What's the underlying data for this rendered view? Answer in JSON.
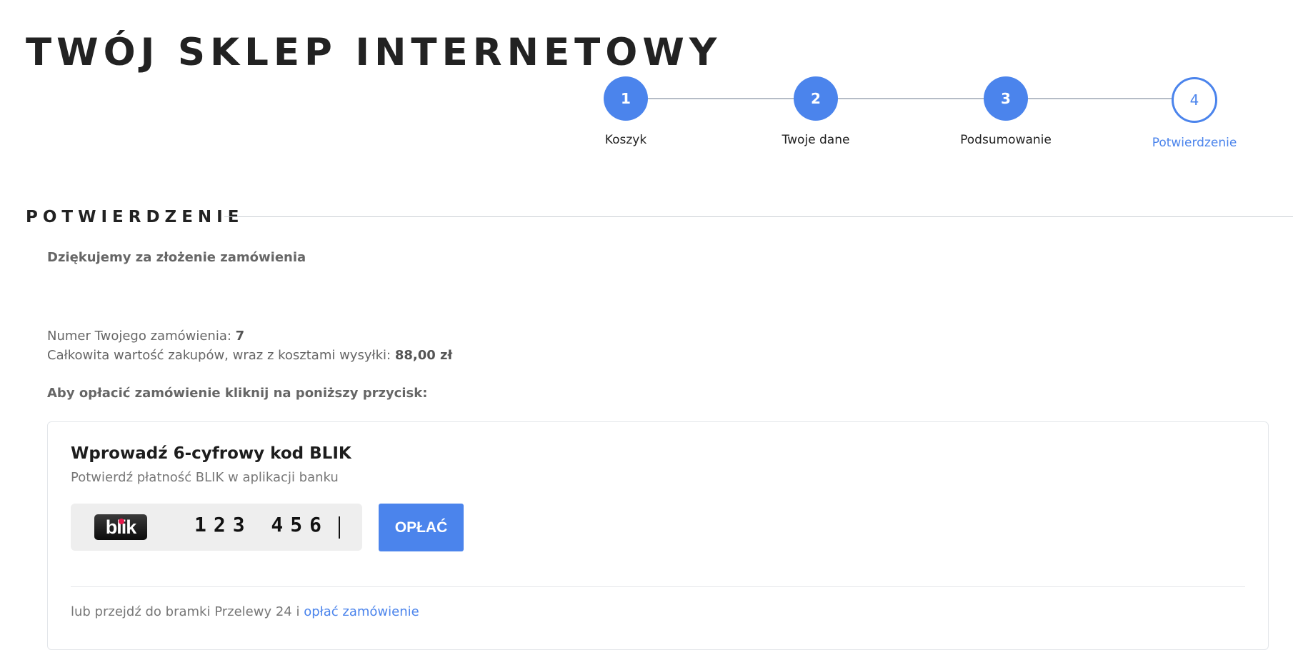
{
  "header": {
    "shop_title": "TWÓJ SKLEP INTERNETOWY"
  },
  "steps": [
    {
      "number": "1",
      "label": "Koszyk",
      "state": "done"
    },
    {
      "number": "2",
      "label": "Twoje dane",
      "state": "done"
    },
    {
      "number": "3",
      "label": "Podsumowanie",
      "state": "done"
    },
    {
      "number": "4",
      "label": "Potwierdzenie",
      "state": "current"
    }
  ],
  "section": {
    "title": "POTWIERDZENIE"
  },
  "confirmation": {
    "thanks": "Dziękujemy za złożenie zamówienia",
    "order_number_label": "Numer Twojego zamówienia: ",
    "order_number": "7",
    "total_label": "Całkowita wartość zakupów, wraz z kosztami wysyłki: ",
    "total_value": "88,00 zł",
    "pay_prompt": "Aby opłacić zamówienie kliknij na poniższy przycisk:"
  },
  "blik": {
    "title": "Wprowadź 6-cyfrowy kod BLIK",
    "subtitle": "Potwierdź płatność BLIK w aplikacji banku",
    "logo_text": "blik",
    "code_value": "123 456",
    "pay_button": "OPŁAĆ",
    "gateway_text": "lub przejdź do bramki Przelewy 24 i ",
    "gateway_link": "opłać zamówienie"
  },
  "colors": {
    "accent": "#4b84ec",
    "title": "#222222",
    "muted": "#666666"
  }
}
